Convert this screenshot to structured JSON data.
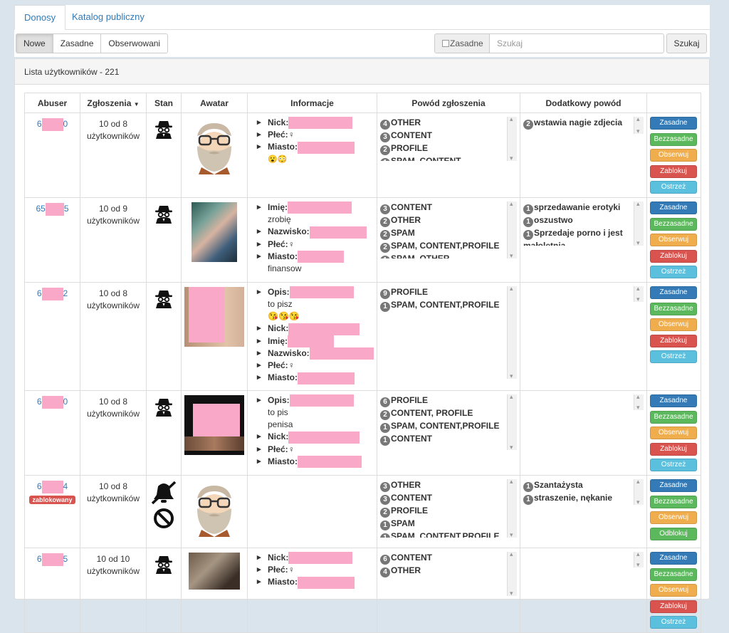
{
  "tabs": [
    {
      "label": "Donosy",
      "active": true
    },
    {
      "label": "Katalog publiczny",
      "active": false
    }
  ],
  "filters": [
    {
      "label": "Nowe",
      "active": true
    },
    {
      "label": "Zasadne",
      "active": false
    },
    {
      "label": "Obserwowani",
      "active": false
    }
  ],
  "search": {
    "checkbox_label": "Zasadne",
    "placeholder": "Szukaj",
    "button": "Szukaj"
  },
  "panel": {
    "title": "Lista użytkowników - 221"
  },
  "columns": [
    "Abuser",
    "Zgłoszenia",
    "Stan",
    "Awatar",
    "Informacje",
    "Powód zgłoszenia",
    "Dodatkowy powód",
    ""
  ],
  "action_labels": {
    "accept": "Zasadne",
    "reject": "Bezzasadne",
    "watch": "Obserwuj",
    "block": "Zablokuj",
    "unblock": "Odblokuj",
    "warn": "Ostrzeż"
  },
  "rows": [
    {
      "id_start": "6",
      "id_end": "0",
      "reports_line1": "10 od 8",
      "reports_line2": "użytkowników",
      "status_icon": "spy-icon",
      "avatar": "default-bearded-avatar",
      "info": [
        {
          "label": "Nick:"
        },
        {
          "label": "Płeć:",
          "value": "♀"
        },
        {
          "label": "Miasto:"
        }
      ],
      "info_extra": "😮😳",
      "reasons": [
        {
          "count": "4",
          "text": "OTHER"
        },
        {
          "count": "3",
          "text": "CONTENT"
        },
        {
          "count": "2",
          "text": "PROFILE"
        },
        {
          "count": "1",
          "text": "SPAM, CONTENT"
        }
      ],
      "extra_reasons": [
        {
          "count": "2",
          "text": "wstawia nagie zdjecia"
        }
      ]
    },
    {
      "id_start": "65",
      "id_end": "5",
      "reports_line1": "10 od 9",
      "reports_line2": "użytkowników",
      "status_icon": "spy-icon",
      "avatar": "pixelated-photo",
      "info": [
        {
          "label": "Imię:"
        },
        {
          "sub": "zrobię"
        },
        {
          "label": "Nazwisko:"
        },
        {
          "label": "Płeć:",
          "value": "♀"
        },
        {
          "label": "Miasto:"
        },
        {
          "sub": "finansow"
        }
      ],
      "reasons": [
        {
          "count": "3",
          "text": "CONTENT"
        },
        {
          "count": "2",
          "text": "OTHER"
        },
        {
          "count": "2",
          "text": "SPAM"
        },
        {
          "count": "2",
          "text": "SPAM, CONTENT,PROFILE"
        },
        {
          "count": "1",
          "text": "SPAM, OTHER"
        }
      ],
      "extra_reasons": [
        {
          "count": "1",
          "text": "sprzedawanie erotyki"
        },
        {
          "count": "1",
          "text": "oszustwo"
        },
        {
          "count": "1",
          "text": "Sprzedaje porno i jest małoletnia"
        }
      ]
    },
    {
      "id_start": "6",
      "id_end": "2",
      "reports_line1": "10 od 8",
      "reports_line2": "użytkowników",
      "status_icon": "spy-icon",
      "avatar": "censored-photo",
      "info": [
        {
          "label": "Opis:"
        },
        {
          "sub": "to pisz"
        },
        {
          "sub": "😘😘😘"
        },
        {
          "label": "Nick:"
        },
        {
          "label": "Imię:"
        },
        {
          "label": "Nazwisko:"
        },
        {
          "label": "Płeć:",
          "value": "♀"
        },
        {
          "label": "Miasto:"
        }
      ],
      "reasons": [
        {
          "count": "9",
          "text": "PROFILE"
        },
        {
          "count": "1",
          "text": "SPAM, CONTENT,PROFILE"
        }
      ],
      "extra_reasons": []
    },
    {
      "id_start": "6",
      "id_end": "0",
      "reports_line1": "10 od 8",
      "reports_line2": "użytkowników",
      "status_icon": "spy-icon",
      "avatar": "censored-photo-dark",
      "info": [
        {
          "label": "Opis:"
        },
        {
          "sub": "to pis"
        },
        {
          "sub": "penisa"
        },
        {
          "label": "Nick:"
        },
        {
          "label": "Płeć:",
          "value": "♀"
        },
        {
          "label": "Miasto:"
        }
      ],
      "reasons": [
        {
          "count": "6",
          "text": "PROFILE"
        },
        {
          "count": "2",
          "text": "CONTENT, PROFILE"
        },
        {
          "count": "1",
          "text": "SPAM, CONTENT,PROFILE"
        },
        {
          "count": "1",
          "text": "CONTENT"
        }
      ],
      "extra_reasons": []
    },
    {
      "id_start": "6",
      "id_end": "4",
      "badge": "zablokowany",
      "reports_line1": "10 od 8",
      "reports_line2": "użytkowników",
      "status_icon": "muted-bell-ban-icon",
      "avatar": "default-bearded-avatar",
      "info": [],
      "reasons": [
        {
          "count": "3",
          "text": "OTHER"
        },
        {
          "count": "3",
          "text": "CONTENT"
        },
        {
          "count": "2",
          "text": "PROFILE"
        },
        {
          "count": "1",
          "text": "SPAM"
        },
        {
          "count": "1",
          "text": "SPAM, CONTENT,PROFILE"
        }
      ],
      "extra_reasons": [
        {
          "count": "1",
          "text": "Szantażysta"
        },
        {
          "count": "1",
          "text": "straszenie, nękanie"
        }
      ]
    },
    {
      "id_start": "6",
      "id_end": "5",
      "reports_line1": "10 od 10",
      "reports_line2": "użytkowników",
      "status_icon": "spy-icon",
      "avatar": "pixelated-photo-dark",
      "info": [
        {
          "label": "Nick:"
        },
        {
          "label": "Płeć:",
          "value": "♀"
        },
        {
          "label": "Miasto:"
        }
      ],
      "reasons": [
        {
          "count": "6",
          "text": "CONTENT"
        },
        {
          "count": "4",
          "text": "OTHER"
        }
      ],
      "extra_reasons": []
    }
  ]
}
